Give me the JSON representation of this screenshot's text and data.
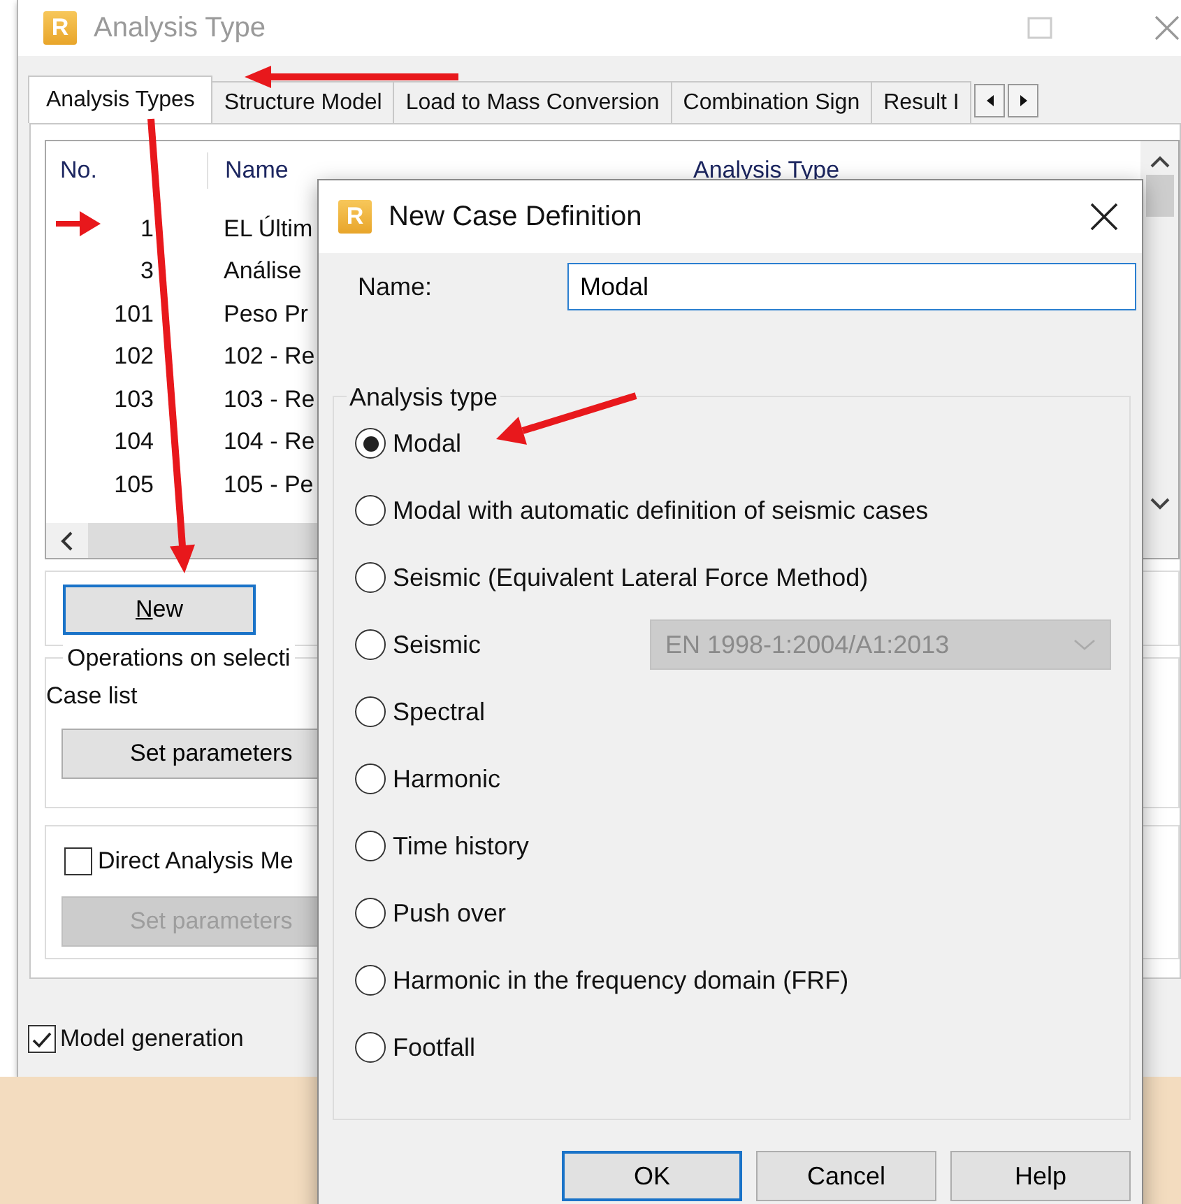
{
  "window": {
    "icon_text": "R",
    "title": "Analysis Type"
  },
  "tabs": [
    {
      "label": "Analysis Types",
      "selected": true
    },
    {
      "label": "Structure Model",
      "selected": false
    },
    {
      "label": "Load to Mass Conversion",
      "selected": false
    },
    {
      "label": "Combination Sign",
      "selected": false
    },
    {
      "label": "Result I",
      "selected": false
    }
  ],
  "case_table": {
    "columns": [
      "No.",
      "Name",
      "Analysis Type"
    ],
    "rows": [
      {
        "no": "1",
        "name": "EL Últim"
      },
      {
        "no": "3",
        "name": "Análise"
      },
      {
        "no": "101",
        "name": "Peso Pr"
      },
      {
        "no": "102",
        "name": "102 - Re"
      },
      {
        "no": "103",
        "name": "103 - Re"
      },
      {
        "no": "104",
        "name": "104 - Re"
      },
      {
        "no": "105",
        "name": "105 - Pe"
      }
    ]
  },
  "new_button": {
    "label": "New"
  },
  "operations_group": {
    "title": "Operations on selecti",
    "case_list_label": "Case list",
    "set_parameters": {
      "label": "Set parameters",
      "disabled": false
    }
  },
  "direct_analysis": {
    "label": "Direct Analysis Me",
    "checked": false,
    "set_parameters": {
      "label": "Set parameters",
      "disabled": true
    }
  },
  "model_generation": {
    "label": "Model generation",
    "checked": true
  },
  "dialog": {
    "icon_text": "R",
    "title": "New Case Definition",
    "name_label": "Name:",
    "name_value": "Modal",
    "group_title": "Analysis type",
    "options": [
      {
        "label": "Modal",
        "selected": true
      },
      {
        "label": "Modal with automatic definition of seismic cases",
        "selected": false
      },
      {
        "label": "Seismic (Equivalent Lateral Force Method)",
        "selected": false
      },
      {
        "label": "Seismic",
        "selected": false,
        "code_select": {
          "value": "EN 1998-1:2004/A1:2013",
          "disabled": true
        }
      },
      {
        "label": "Spectral",
        "selected": false
      },
      {
        "label": "Harmonic",
        "selected": false
      },
      {
        "label": "Time history",
        "selected": false
      },
      {
        "label": "Push over",
        "selected": false
      },
      {
        "label": "Harmonic in the frequency domain (FRF)",
        "selected": false
      },
      {
        "label": "Footfall",
        "selected": false
      }
    ],
    "buttons": [
      {
        "label": "OK",
        "default": true
      },
      {
        "label": "Cancel",
        "default": false
      },
      {
        "label": "Help",
        "default": false
      }
    ]
  }
}
